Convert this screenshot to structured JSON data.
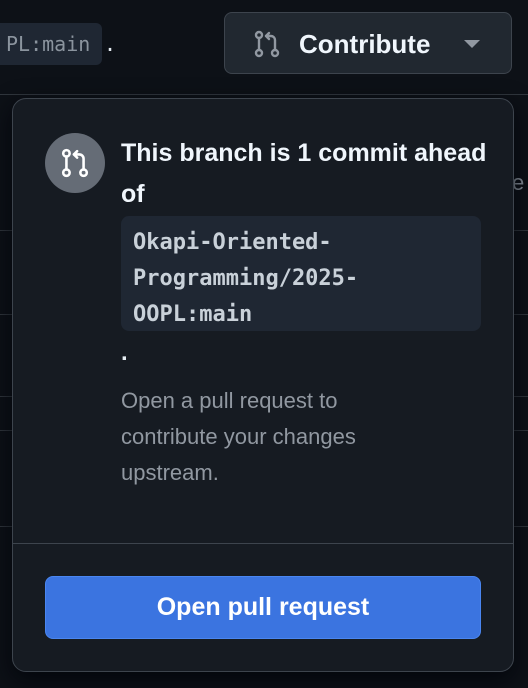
{
  "background": {
    "branch_ref": "PL:main",
    "branch_ref_suffix": ".",
    "edge_text": "e",
    "contribute_button": {
      "label": "Contribute",
      "icon": "git-pull-request-icon",
      "caret": "chevron-down-icon"
    }
  },
  "popover": {
    "icon": "git-pull-request-icon",
    "title": "This branch is 1 commit ahead of",
    "upstream_ref": "Okapi-Oriented-\nProgramming/2025-\nOOPL:main",
    "period": ".",
    "description": "Open a pull request to contribute your changes upstream.",
    "primary_button_label": "Open pull request"
  },
  "colors": {
    "background": "#0d1117",
    "popover_bg": "#161b22",
    "border": "#3d444d",
    "primary_button": "#3b74e0",
    "muted_text": "#9198a1"
  }
}
